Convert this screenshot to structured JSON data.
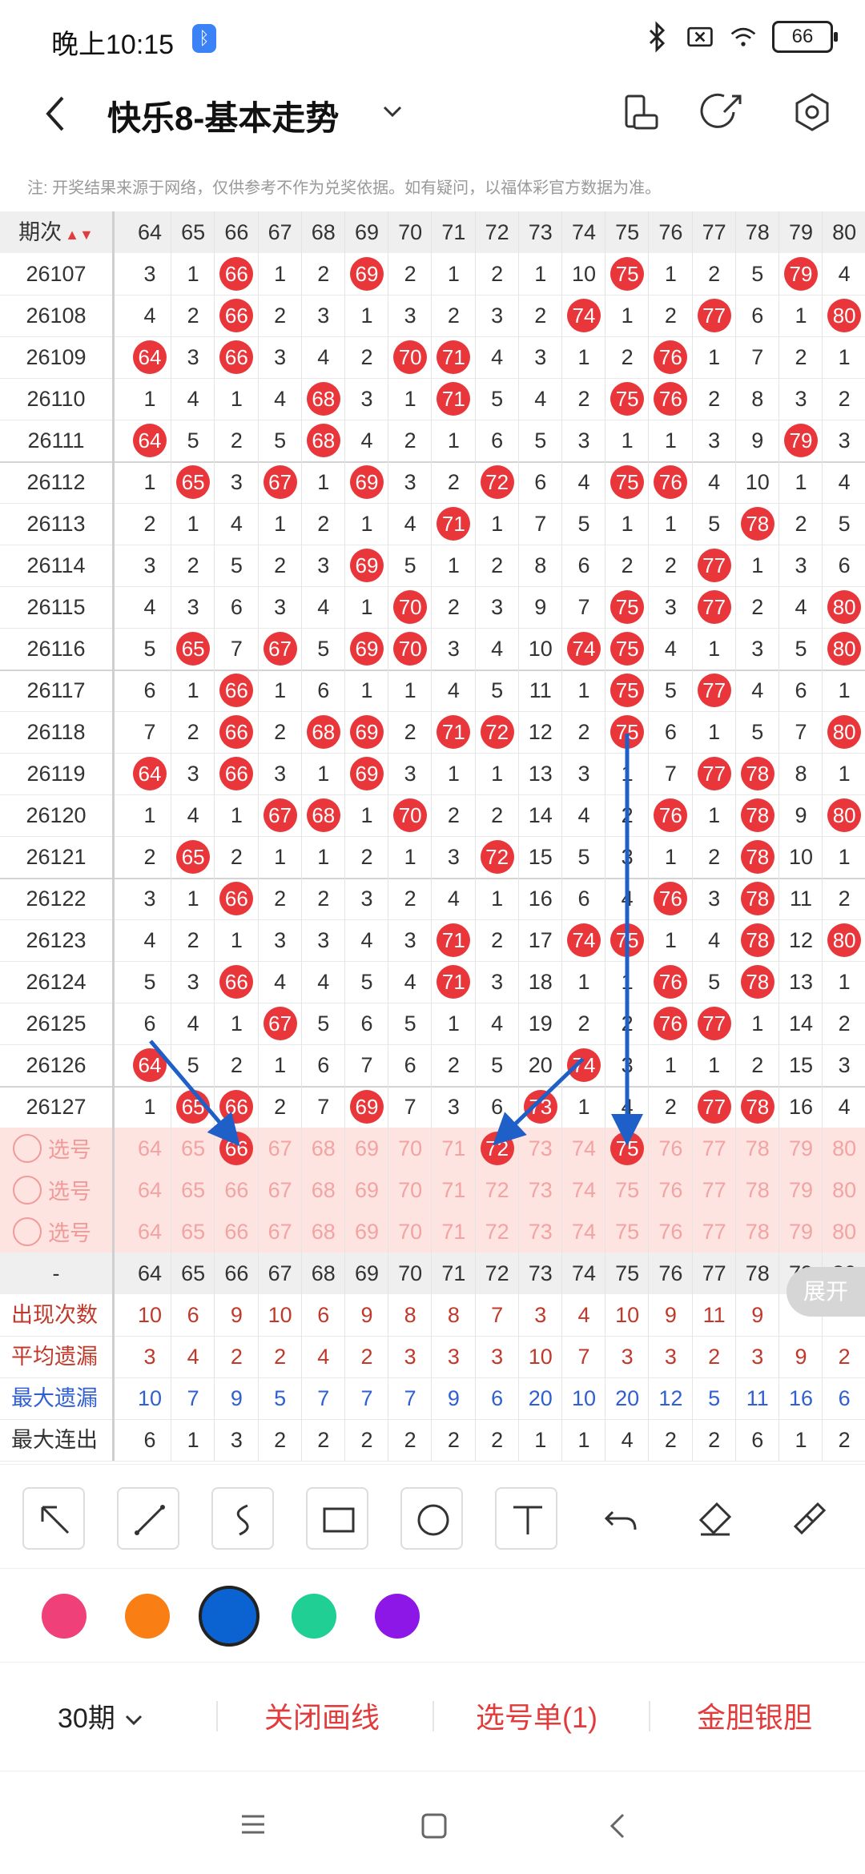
{
  "status": {
    "time": "晚上10:15",
    "battery": "66"
  },
  "title": {
    "text": "快乐8-基本走势"
  },
  "notice": "注: 开奖结果来源于网络，仅供参考不作为兑奖依据。如有疑问，以福体彩官方数据为准。",
  "header": {
    "issue_label": "期次",
    "cols": [
      "64",
      "65",
      "66",
      "67",
      "68",
      "69",
      "70",
      "71",
      "72",
      "73",
      "74",
      "75",
      "76",
      "77",
      "78",
      "79",
      "80"
    ]
  },
  "rows": [
    {
      "issue": "26107",
      "v": [
        "3",
        "1",
        "66",
        "1",
        "2",
        "69",
        "2",
        "1",
        "2",
        "1",
        "10",
        "75",
        "1",
        "2",
        "5",
        "79",
        "4"
      ]
    },
    {
      "issue": "26108",
      "v": [
        "4",
        "2",
        "66",
        "2",
        "3",
        "1",
        "3",
        "2",
        "3",
        "2",
        "74",
        "1",
        "2",
        "77",
        "6",
        "1",
        "80"
      ]
    },
    {
      "issue": "26109",
      "v": [
        "64",
        "3",
        "66",
        "3",
        "4",
        "2",
        "70",
        "71",
        "4",
        "3",
        "1",
        "2",
        "76",
        "1",
        "7",
        "2",
        "1"
      ]
    },
    {
      "issue": "26110",
      "v": [
        "1",
        "4",
        "1",
        "4",
        "68",
        "3",
        "1",
        "71",
        "5",
        "4",
        "2",
        "75",
        "76",
        "2",
        "8",
        "3",
        "2"
      ]
    },
    {
      "issue": "26111",
      "v": [
        "64",
        "5",
        "2",
        "5",
        "68",
        "4",
        "2",
        "1",
        "6",
        "5",
        "3",
        "1",
        "1",
        "3",
        "9",
        "79",
        "3"
      ]
    },
    {
      "issue": "26112",
      "v": [
        "1",
        "65",
        "3",
        "67",
        "1",
        "69",
        "3",
        "2",
        "72",
        "6",
        "4",
        "75",
        "76",
        "4",
        "10",
        "1",
        "4"
      ]
    },
    {
      "issue": "26113",
      "v": [
        "2",
        "1",
        "4",
        "1",
        "2",
        "1",
        "4",
        "71",
        "1",
        "7",
        "5",
        "1",
        "1",
        "5",
        "78",
        "2",
        "5"
      ]
    },
    {
      "issue": "26114",
      "v": [
        "3",
        "2",
        "5",
        "2",
        "3",
        "69",
        "5",
        "1",
        "2",
        "8",
        "6",
        "2",
        "2",
        "77",
        "1",
        "3",
        "6"
      ]
    },
    {
      "issue": "26115",
      "v": [
        "4",
        "3",
        "6",
        "3",
        "4",
        "1",
        "70",
        "2",
        "3",
        "9",
        "7",
        "75",
        "3",
        "77",
        "2",
        "4",
        "80"
      ]
    },
    {
      "issue": "26116",
      "v": [
        "5",
        "65",
        "7",
        "67",
        "5",
        "69",
        "70",
        "3",
        "4",
        "10",
        "74",
        "75",
        "4",
        "1",
        "3",
        "5",
        "80"
      ]
    },
    {
      "issue": "26117",
      "v": [
        "6",
        "1",
        "66",
        "1",
        "6",
        "1",
        "1",
        "4",
        "5",
        "11",
        "1",
        "75",
        "5",
        "77",
        "4",
        "6",
        "1"
      ]
    },
    {
      "issue": "26118",
      "v": [
        "7",
        "2",
        "66",
        "2",
        "68",
        "69",
        "2",
        "71",
        "72",
        "12",
        "2",
        "75",
        "6",
        "1",
        "5",
        "7",
        "80"
      ]
    },
    {
      "issue": "26119",
      "v": [
        "64",
        "3",
        "66",
        "3",
        "1",
        "69",
        "3",
        "1",
        "1",
        "13",
        "3",
        "1",
        "7",
        "77",
        "78",
        "8",
        "1"
      ]
    },
    {
      "issue": "26120",
      "v": [
        "1",
        "4",
        "1",
        "67",
        "68",
        "1",
        "70",
        "2",
        "2",
        "14",
        "4",
        "2",
        "76",
        "1",
        "78",
        "9",
        "80"
      ]
    },
    {
      "issue": "26121",
      "v": [
        "2",
        "65",
        "2",
        "1",
        "1",
        "2",
        "1",
        "3",
        "72",
        "15",
        "5",
        "3",
        "1",
        "2",
        "78",
        "10",
        "1"
      ]
    },
    {
      "issue": "26122",
      "v": [
        "3",
        "1",
        "66",
        "2",
        "2",
        "3",
        "2",
        "4",
        "1",
        "16",
        "6",
        "4",
        "76",
        "3",
        "78",
        "11",
        "2"
      ]
    },
    {
      "issue": "26123",
      "v": [
        "4",
        "2",
        "1",
        "3",
        "3",
        "4",
        "3",
        "71",
        "2",
        "17",
        "74",
        "75",
        "1",
        "4",
        "78",
        "12",
        "80"
      ]
    },
    {
      "issue": "26124",
      "v": [
        "5",
        "3",
        "66",
        "4",
        "4",
        "5",
        "4",
        "71",
        "3",
        "18",
        "1",
        "1",
        "76",
        "5",
        "78",
        "13",
        "1"
      ]
    },
    {
      "issue": "26125",
      "v": [
        "6",
        "4",
        "1",
        "67",
        "5",
        "6",
        "5",
        "1",
        "4",
        "19",
        "2",
        "2",
        "76",
        "77",
        "1",
        "14",
        "2"
      ]
    },
    {
      "issue": "26126",
      "v": [
        "64",
        "5",
        "2",
        "1",
        "6",
        "7",
        "6",
        "2",
        "5",
        "20",
        "74",
        "3",
        "1",
        "1",
        "2",
        "15",
        "3"
      ]
    },
    {
      "issue": "26127",
      "v": [
        "1",
        "65",
        "66",
        "2",
        "7",
        "69",
        "7",
        "3",
        "6",
        "73",
        "1",
        "4",
        "2",
        "77",
        "78",
        "16",
        "4"
      ]
    }
  ],
  "pick_rows": [
    {
      "label": "选号",
      "selected": [
        "66",
        "72",
        "75"
      ]
    },
    {
      "label": "选号",
      "selected": []
    },
    {
      "label": "选号",
      "selected": []
    }
  ],
  "footer_header": {
    "dash": "-"
  },
  "stats": [
    {
      "label": "出现次数",
      "color": "#c0392b",
      "v": [
        "10",
        "6",
        "9",
        "10",
        "6",
        "9",
        "8",
        "8",
        "7",
        "3",
        "4",
        "10",
        "9",
        "11",
        "9",
        "",
        ""
      ]
    },
    {
      "label": "平均遗漏",
      "color": "#c0392b",
      "v": [
        "3",
        "4",
        "2",
        "2",
        "4",
        "2",
        "3",
        "3",
        "3",
        "10",
        "7",
        "3",
        "3",
        "2",
        "3",
        "9",
        "2"
      ]
    },
    {
      "label": "最大遗漏",
      "color": "#2f5fd0",
      "v": [
        "10",
        "7",
        "9",
        "5",
        "7",
        "7",
        "7",
        "9",
        "6",
        "20",
        "10",
        "20",
        "12",
        "5",
        "11",
        "16",
        "6"
      ]
    },
    {
      "label": "最大连出",
      "color": "#333333",
      "v": [
        "6",
        "1",
        "3",
        "2",
        "2",
        "2",
        "2",
        "2",
        "2",
        "1",
        "1",
        "4",
        "2",
        "2",
        "6",
        "1",
        "2"
      ]
    }
  ],
  "expand_label": "展开",
  "tools": [
    "arrow-tool",
    "line-tool",
    "curve-tool",
    "rectangle-tool",
    "circle-tool",
    "text-tool",
    "undo-tool",
    "eraser-tool",
    "clear-tool"
  ],
  "palette": [
    "#f0407a",
    "#f97f14",
    "#0b63d1",
    "#1fcf94",
    "#8d17e6"
  ],
  "bottom": {
    "period": "30期",
    "close_draw": "关闭画线",
    "pick_list": "选号单(1)",
    "gold_silver": "金胆银胆"
  }
}
